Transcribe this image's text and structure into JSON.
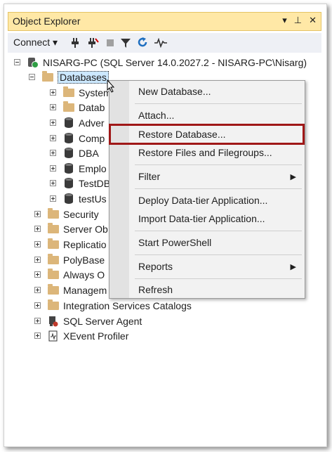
{
  "window": {
    "title": "Object Explorer",
    "ctrl_dropdown": "▾",
    "ctrl_pin": "⊥",
    "ctrl_close": "✕"
  },
  "toolbar": {
    "connect_label": "Connect",
    "connect_arrow": "▾"
  },
  "tree": {
    "server": "NISARG-PC (SQL Server 14.0.2027.2 - NISARG-PC\\Nisarg)",
    "databases": "Databases",
    "db_children": [
      "System",
      "Datab",
      "Adver",
      "Comp",
      "DBA",
      "Emplo",
      "TestDB",
      "testUs"
    ],
    "siblings": [
      "Security",
      "Server Ob",
      "Replicatio",
      "PolyBase",
      "Always O",
      "Managem",
      "Integration Services Catalogs",
      "SQL Server Agent",
      "XEvent Profiler"
    ]
  },
  "context_menu": {
    "items": [
      "New Database...",
      "Attach...",
      "Restore Database...",
      "Restore Files and Filegroups...",
      "Filter",
      "Deploy Data-tier Application...",
      "Import Data-tier Application...",
      "Start PowerShell",
      "Reports",
      "Refresh"
    ],
    "submenu_arrow": "▶"
  }
}
